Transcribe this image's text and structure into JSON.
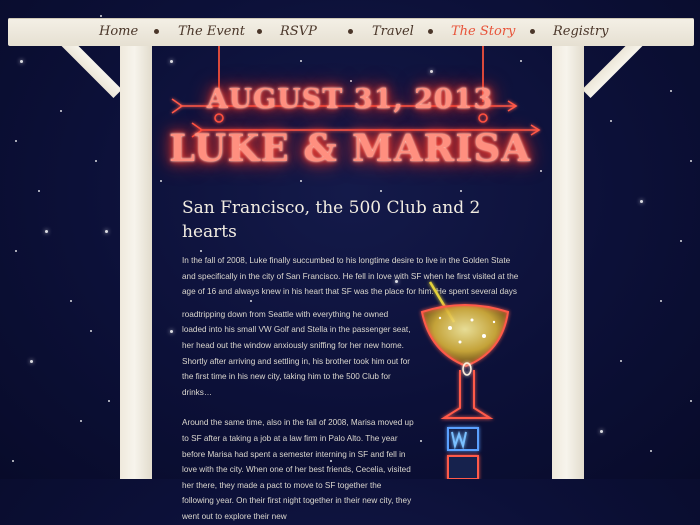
{
  "nav": {
    "items": [
      {
        "label": "Home",
        "active": false
      },
      {
        "label": "The Event",
        "active": false
      },
      {
        "label": "RSVP",
        "active": false
      },
      {
        "label": "Travel",
        "active": false
      },
      {
        "label": "The Story",
        "active": true
      },
      {
        "label": "Registry",
        "active": false
      }
    ]
  },
  "sign": {
    "date": "AUGUST 31, 2013",
    "names": "LUKE & MARISA"
  },
  "story": {
    "heading": "San Francisco, the 500 Club and 2 hearts",
    "paragraph1": "In the fall of 2008, Luke finally succumbed to his longtime desire to live in the Golden State and specifically in the city of San Francisco. He fell in love with SF when he first visited at the age of 16 and always knew in his heart that SF was the place for him. He spent several days",
    "paragraph1b": "roadtripping down from Seattle with everything he owned loaded into his small VW Golf and Stella in the passenger seat, her head out the window anxiously sniffing for her new home. Shortly after arriving and settling in, his brother took him out for the first time in his new city, taking him to the 500 Club for drinks…",
    "paragraph2": "Around the same time, also in the fall of 2008, Marisa moved up to SF after a taking a job at a law firm in Palo Alto. The year before Marisa had spent a semester interning in SF and fell in love with the city. When one of her best friends, Cecelia, visited her there, they made a pact to move to SF together the following year. On their first night together in their new city, they went out to explore their new"
  },
  "colors": {
    "sky": "#0c1038",
    "wood": "#f4f0e6",
    "nav_text": "#4a3629",
    "nav_active": "#e8543a",
    "neon": "#ff4a3a"
  }
}
